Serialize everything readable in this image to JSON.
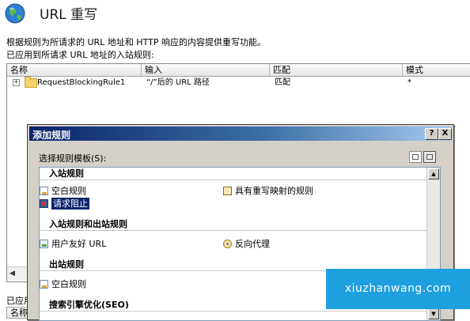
{
  "header": {
    "title": "URL 重写",
    "description": "根据规则为所请求的 URL 地址和 HTTP 响应的内容提供重写功能。",
    "applied_inbound_label": "已应用到所请求 URL 地址的入站规则:",
    "applied_outbound_label": "已应用"
  },
  "rules_table": {
    "columns": [
      "名称",
      "输入",
      "匹配",
      "模式"
    ],
    "rows": [
      {
        "name": "RequestBlockingRule1",
        "input": "“/”后的 URL 路径",
        "match": "匹配",
        "pattern": "*"
      }
    ],
    "expander": "+",
    "scroll_left": "◀",
    "second_header_first": "名称"
  },
  "dialog": {
    "title": "添加规则",
    "help_button": "?",
    "close_button": "X",
    "template_label": "选择规则模板(S):",
    "scroll_up": "▲",
    "scroll_down": "▼",
    "sections": [
      {
        "title": "入站规则",
        "items": [
          "空白规则",
          "具有重写映射的规则",
          "请求阻止"
        ]
      },
      {
        "title": "入站规则和出站规则",
        "items": [
          "用户友好 URL",
          "反向代理"
        ]
      },
      {
        "title": "出站规则",
        "items": [
          "空白规则"
        ]
      },
      {
        "title": "搜索引擎优化(SEO)",
        "items": []
      }
    ],
    "selected_item": "请求阻止"
  },
  "watermark": "xiuzhanwang.com",
  "colors": {
    "titlebar_start": "#0a246a",
    "titlebar_end": "#a6caf0",
    "selection": "#0a246a",
    "watermark_bg": "#1e9fe0"
  },
  "icons": {
    "page": "globe-icon",
    "rule": "folder-icon",
    "blank_rule": "blank-rule-icon",
    "map_rule": "rewrite-map-icon",
    "block_rule": "request-block-icon",
    "friendly_url": "friendly-url-icon",
    "reverse_proxy": "reverse-proxy-icon"
  }
}
